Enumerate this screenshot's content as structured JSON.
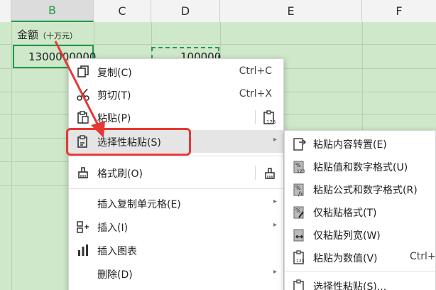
{
  "columns": [
    "B",
    "C",
    "D",
    "E",
    "F"
  ],
  "cells": {
    "b1_label": "金额",
    "b1_unit": "（十万元）",
    "b2_value": "1300000000",
    "d2_value": "100000"
  },
  "context_menu": {
    "items": [
      {
        "label": "复制(C)",
        "shortcut": "Ctrl+C",
        "icon": "copy-icon"
      },
      {
        "label": "剪切(T)",
        "shortcut": "Ctrl+X",
        "icon": "scissors-icon"
      },
      {
        "label": "粘贴(P)",
        "shortcut": "",
        "icon": "paste-icon"
      },
      {
        "label": "选择性粘贴(S)",
        "shortcut": "",
        "icon": "paste-special-icon"
      },
      {
        "label": "格式刷(O)",
        "shortcut": "",
        "icon": "format-brush-icon"
      },
      {
        "label": "插入复制单元格(E)",
        "shortcut": "",
        "icon": ""
      },
      {
        "label": "插入(I)",
        "shortcut": "",
        "icon": "insert-icon"
      },
      {
        "label": "插入图表",
        "shortcut": "",
        "icon": "chart-icon"
      },
      {
        "label": "删除(D)",
        "shortcut": "",
        "icon": ""
      }
    ]
  },
  "paste_special_submenu": {
    "items": [
      {
        "label": "粘贴内容转置(E)",
        "icon": "transpose-icon"
      },
      {
        "label": "粘贴值和数字格式(U)",
        "icon": "paste-values-numbers-icon"
      },
      {
        "label": "粘贴公式和数字格式(R)",
        "icon": "paste-formula-icon"
      },
      {
        "label": "仅粘贴格式(T)",
        "icon": "paste-format-icon"
      },
      {
        "label": "仅粘贴列宽(W)",
        "icon": "paste-column-width-icon"
      },
      {
        "label": "粘贴为数值(V)",
        "shortcut": "Ctrl+",
        "icon": "paste-as-values-icon"
      },
      {
        "label": "选择性粘贴(S)...",
        "icon": "paste-special-icon"
      }
    ]
  },
  "colors": {
    "grid_bg": "#cfe8c9",
    "accent": "#1f9a4a",
    "annotation": "#e53935"
  }
}
